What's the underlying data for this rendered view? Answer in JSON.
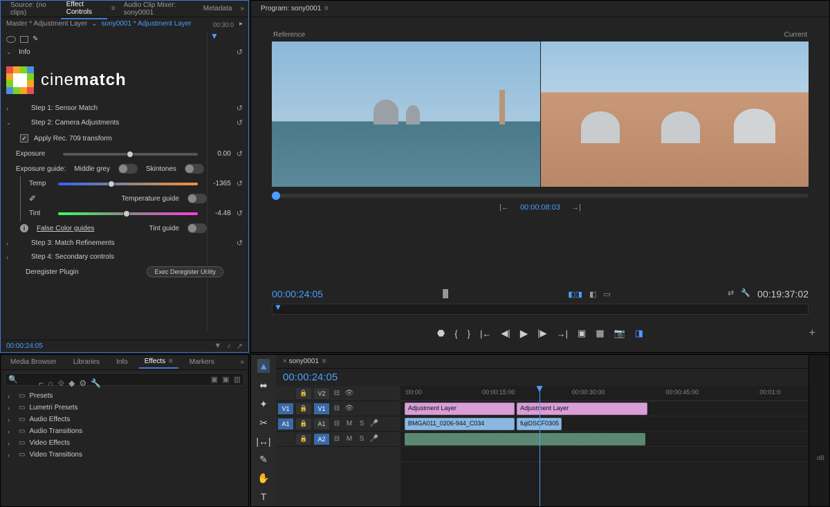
{
  "topLeft": {
    "tabs": {
      "source": "Source: (no clips)",
      "effectControls": "Effect Controls",
      "audioMixer": "Audio Clip Mixer: sony0001",
      "metadata": "Metadata"
    },
    "master": "Master * Adjustment Layer",
    "sequence": "sony0001 * Adjustment Layer",
    "stripTime": "00:30:0",
    "info": "Info",
    "brand": {
      "a": "cine",
      "b": "match"
    },
    "step1": "Step 1: Sensor Match",
    "step2": "Step 2: Camera Adjustments",
    "apply709": "Apply Rec. 709 transform",
    "exposureLabel": "Exposure",
    "exposureVal": "0.00",
    "exposureGuide": "Exposure guide:",
    "middleGrey": "Middle grey",
    "skintones": "Skintones",
    "temp": "Temp",
    "tempVal": "-1365",
    "tempGuideLabel": "Temperature guide",
    "tint": "Tint",
    "tintVal": "-4.48",
    "falseColor": "False Color guides",
    "tintGuideLabel": "Tint guide",
    "step3": "Step 3: Match Refinements",
    "step4": "Step 4: Secondary controls",
    "deregister": "Deregister Plugin",
    "execBtn": "Exec Deregister Utility",
    "footerTime": "00:00:24:05"
  },
  "program": {
    "title": "Program: sony0001",
    "reference": "Reference",
    "current": "Current",
    "scrubTime": "00:00:08:03",
    "currentTime": "00:00:24:05",
    "duration": "00:19:37:02"
  },
  "lowerLeft": {
    "tabs": {
      "media": "Media Browser",
      "libraries": "Libraries",
      "info": "Info",
      "effects": "Effects",
      "markers": "Markers"
    },
    "items": [
      "Presets",
      "Lumetri Presets",
      "Audio Effects",
      "Audio Transitions",
      "Video Effects",
      "Video Transitions"
    ]
  },
  "timeline": {
    "seqName": "sony0001",
    "timecode": "00:00:24:05",
    "ruler": [
      ":00:00",
      "00:00:15:00",
      "00:00:30:00",
      "00:00:45:00",
      "00:01:0"
    ],
    "tracks": {
      "v2": "V2",
      "v1": "V1",
      "a1": "A1",
      "a2": "A2"
    },
    "trackBtns": {
      "v1side": "V1",
      "a1side": "A1",
      "m": "M",
      "s": "S"
    },
    "clips": {
      "adj1": "Adjustment Layer",
      "adj2": "Adjustment Layer",
      "vid1": "BMGA011_0206-944_C034",
      "vid2": "fujiDSCF0305"
    }
  },
  "audioMeter": {
    "label": "dB"
  }
}
